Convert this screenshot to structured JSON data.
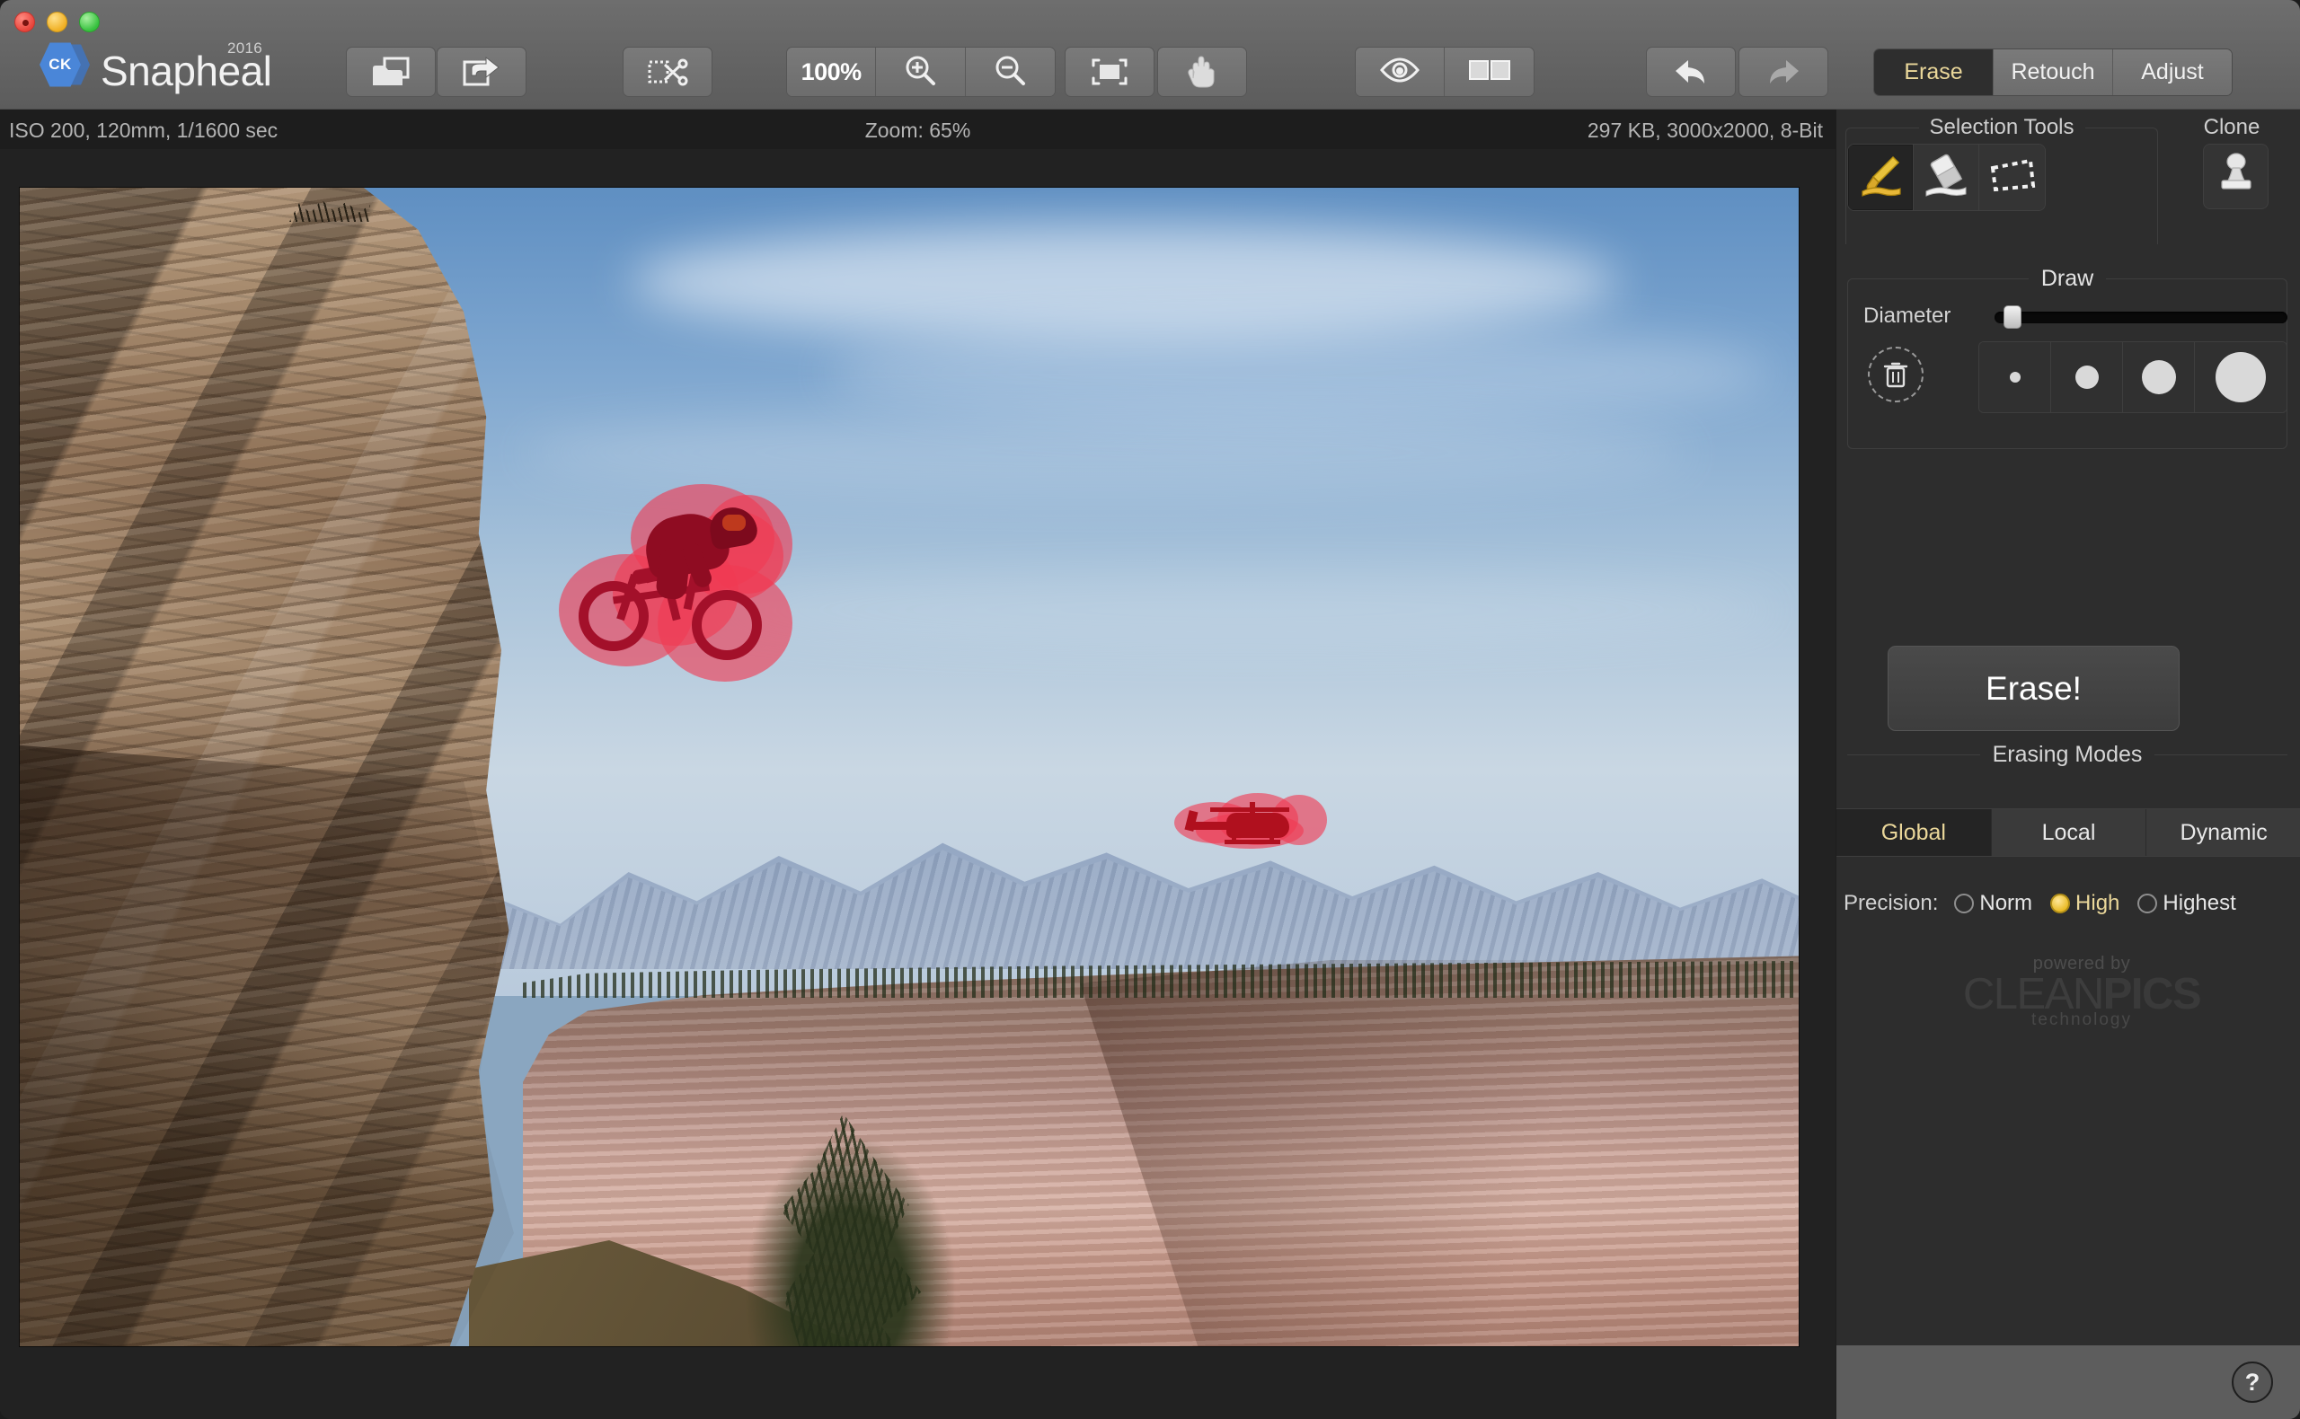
{
  "app": {
    "name": "Snapheal",
    "year_badge": "2016",
    "logo_text": "CK"
  },
  "window_controls": [
    {
      "name": "close",
      "color": "#e8453c"
    },
    {
      "name": "minimize",
      "color": "#f0b024"
    },
    {
      "name": "zoom",
      "color": "#36c13e"
    }
  ],
  "toolbar": {
    "open_icon": "open-folder-icon",
    "share_icon": "share-export-icon",
    "crop_icon": "crop-scissors-icon",
    "zoom_level_label": "100%",
    "zoom_in_icon": "zoom-in-icon",
    "zoom_out_icon": "zoom-out-icon",
    "fit_icon": "fit-to-screen-icon",
    "pan_icon": "hand-pan-icon",
    "preview_icon": "eye-preview-icon",
    "compare_icon": "split-compare-icon",
    "undo_icon": "undo-arrow-icon",
    "redo_icon": "redo-arrow-icon"
  },
  "mode_tabs": [
    {
      "label": "Erase",
      "active": true
    },
    {
      "label": "Retouch",
      "active": false
    },
    {
      "label": "Adjust",
      "active": false
    }
  ],
  "info_bar": {
    "exif": "ISO 200, 120mm, 1/1600 sec",
    "zoom": "Zoom: 65%",
    "file_info": "297 KB, 3000x2000, 8-Bit"
  },
  "sidebar": {
    "selection_tools_title": "Selection Tools",
    "clone_title": "Clone",
    "tools": [
      {
        "name": "brush-tool",
        "icon": "paint-brush-icon",
        "active": true
      },
      {
        "name": "eraser-tool",
        "icon": "eraser-icon",
        "active": false
      },
      {
        "name": "lasso-tool",
        "icon": "lasso-selection-icon",
        "active": false
      }
    ],
    "clone_tool": {
      "name": "clone-stamp-tool",
      "icon": "clone-stamp-icon",
      "active": false
    },
    "draw_title": "Draw",
    "diameter_label": "Diameter",
    "diameter_value": "22",
    "diameter_percent": 6,
    "clear_icon": "trash-clear-selection-icon",
    "brush_presets": [
      {
        "name": "brush-size-xs",
        "size": 12
      },
      {
        "name": "brush-size-s",
        "size": 24
      },
      {
        "name": "brush-size-m",
        "size": 36
      },
      {
        "name": "brush-size-l",
        "size": 52
      }
    ],
    "erase_button": "Erase!",
    "erasing_modes_title": "Erasing Modes",
    "erasing_modes": [
      {
        "label": "Global",
        "active": true
      },
      {
        "label": "Local",
        "active": false
      },
      {
        "label": "Dynamic",
        "active": false
      }
    ],
    "precision_label": "Precision:",
    "precision_options": [
      {
        "label": "Norm",
        "selected": false
      },
      {
        "label": "High",
        "selected": true
      },
      {
        "label": "Highest",
        "selected": false
      }
    ],
    "footer_logo": {
      "line1": "powered by",
      "brand_light": "CLEAN",
      "brand_bold": "PICS",
      "line3": "technology"
    },
    "help_label": "?"
  },
  "colors": {
    "accent_yellow": "#ead79a",
    "selection_red": "#f03a52",
    "titlebar": "#6a6a6a",
    "sidebar": "#2d2d2d",
    "infobar": "#1d1d1d",
    "canvas_bg": "#222222"
  },
  "canvas": {
    "subject_description": "Desert cliff with sky, distant mountains, mesa and bush",
    "selections": [
      {
        "name": "mountain-biker-selection",
        "label": "mountain biker"
      },
      {
        "name": "helicopter-selection",
        "label": "helicopter"
      }
    ]
  }
}
